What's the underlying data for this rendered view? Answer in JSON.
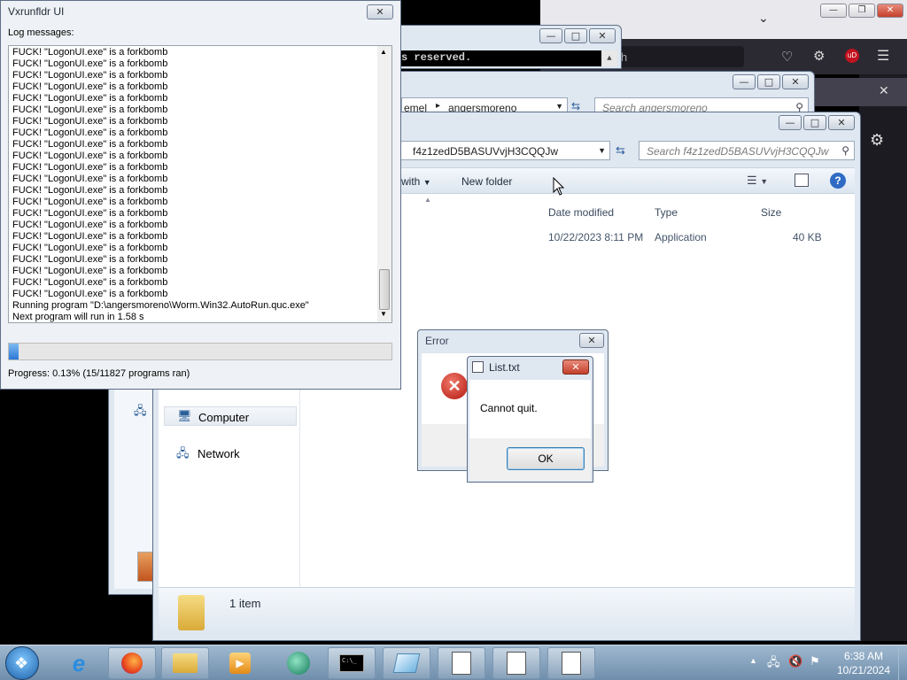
{
  "firefox": {
    "tab_placeholder": "rch"
  },
  "console": {
    "text": "s reserved."
  },
  "explorer_back": {
    "breadcrumb_left": "emel",
    "breadcrumb_right": "angersmoreno",
    "search_placeholder": "Search angersmoreno"
  },
  "explorer": {
    "folder": "f4z1zedD5BASUVvjH3CQQJw",
    "search_placeholder": "Search f4z1zedD5BASUVvjH3CQQJw",
    "toolbar": {
      "open_with": "with",
      "new_folder": "New folder"
    },
    "columns": {
      "date": "Date modified",
      "type": "Type",
      "size": "Size"
    },
    "row": {
      "date": "10/22/2023 8:11 PM",
      "type": "Application",
      "size": "40 KB"
    },
    "nav": {
      "computer": "Computer",
      "network": "Network"
    },
    "status": "1 item"
  },
  "vxrunfldr": {
    "title": "Vxrunfldr UI",
    "log_label": "Log messages:",
    "log_lines": [
      "FUCK! \"LogonUI.exe\" is a forkbomb",
      "FUCK! \"LogonUI.exe\" is a forkbomb",
      "FUCK! \"LogonUI.exe\" is a forkbomb",
      "FUCK! \"LogonUI.exe\" is a forkbomb",
      "FUCK! \"LogonUI.exe\" is a forkbomb",
      "FUCK! \"LogonUI.exe\" is a forkbomb",
      "FUCK! \"LogonUI.exe\" is a forkbomb",
      "FUCK! \"LogonUI.exe\" is a forkbomb",
      "FUCK! \"LogonUI.exe\" is a forkbomb",
      "FUCK! \"LogonUI.exe\" is a forkbomb",
      "FUCK! \"LogonUI.exe\" is a forkbomb",
      "FUCK! \"LogonUI.exe\" is a forkbomb",
      "FUCK! \"LogonUI.exe\" is a forkbomb",
      "FUCK! \"LogonUI.exe\" is a forkbomb",
      "FUCK! \"LogonUI.exe\" is a forkbomb",
      "FUCK! \"LogonUI.exe\" is a forkbomb",
      "FUCK! \"LogonUI.exe\" is a forkbomb",
      "FUCK! \"LogonUI.exe\" is a forkbomb",
      "FUCK! \"LogonUI.exe\" is a forkbomb",
      "FUCK! \"LogonUI.exe\" is a forkbomb",
      "FUCK! \"LogonUI.exe\" is a forkbomb",
      "FUCK! \"LogonUI.exe\" is a forkbomb",
      "Running program \"D:\\angersmoreno\\Worm.Win32.AutoRun.quc.exe\"",
      "Next program will run in 1.58 s"
    ],
    "progress_fraction": 0.0013,
    "progress_text": "Progress: 0.13% (15/11827 programs ran)"
  },
  "error_dialog": {
    "title": "Error"
  },
  "list_dialog": {
    "title": "List.txt",
    "message": "Cannot quit.",
    "ok_label": "OK"
  },
  "taskbar": {
    "time": "6:38 AM",
    "date": "10/21/2024"
  }
}
